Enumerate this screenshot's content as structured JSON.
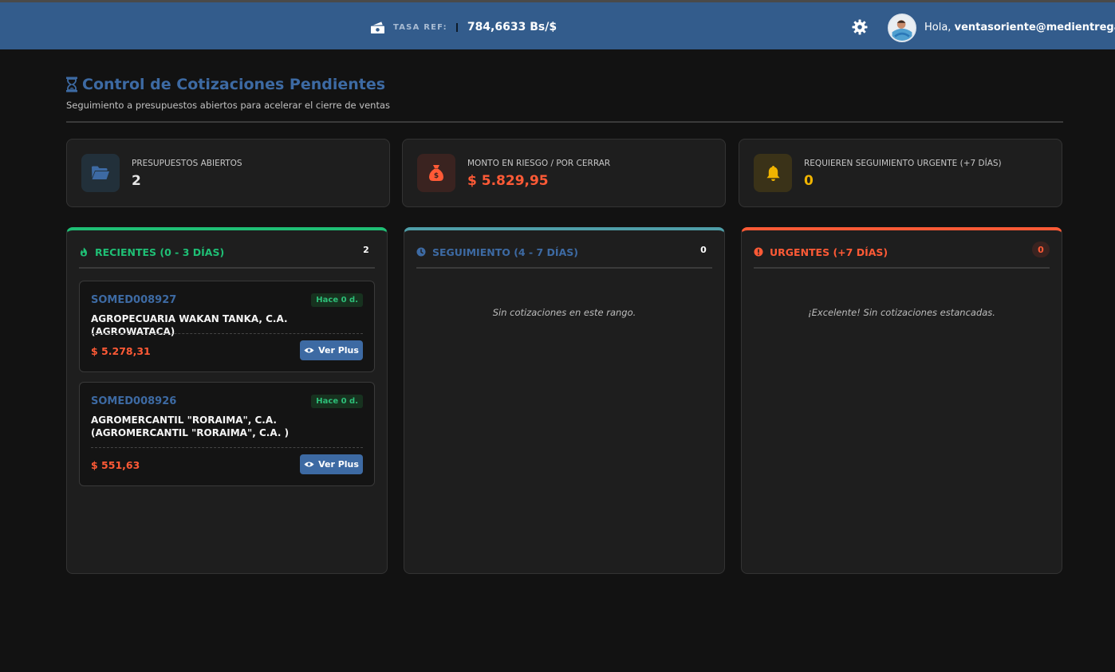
{
  "header": {
    "rate_label": "TASA REF:",
    "rate_value": "784,6633 Bs/$",
    "greeting_prefix": "Hola,",
    "user_email": "ventasoriente@medientregas.n",
    "icons": {
      "rate": "money-bill-icon",
      "settings": "gear-icon",
      "avatar": "user-avatar"
    }
  },
  "page": {
    "title": "Control de Cotizaciones Pendientes",
    "subtitle": "Seguimiento a presupuestos abiertos para acelerar el cierre de ventas",
    "title_icon": "hourglass-icon"
  },
  "stats": [
    {
      "label": "PRESUPUESTOS ABIERTOS",
      "value": "2",
      "icon": "folder-open-icon",
      "color": "#3d6aa3",
      "value_color": "#e6e6e6"
    },
    {
      "label": "MONTO EN RIESGO / POR CERRAR",
      "value": "$ 5.829,95",
      "icon": "money-bag-icon",
      "color": "#ff5a36",
      "value_color": "#ff5a36"
    },
    {
      "label": "REQUIEREN SEGUIMIENTO URGENTE (+7 DÍAS)",
      "value": "0",
      "icon": "bell-icon",
      "color": "#f0b400",
      "value_color": "#f0b400"
    }
  ],
  "columns": [
    {
      "title": "RECIENTES (0 - 3 DÍAS)",
      "count": "2",
      "color": "#1fbf75",
      "icon": "fire-icon",
      "cards": [
        {
          "code": "SOMED008927",
          "age": "Hace 0 d.",
          "client": "AGROPECUARIA WAKAN TANKA, C.A. (AGROWATACA)",
          "amount": "$ 5.278,31",
          "button": "Ver Plus"
        },
        {
          "code": "SOMED008926",
          "age": "Hace 0 d.",
          "client": "AGROMERCANTIL \"RORAIMA\", C.A. (AGROMERCANTIL \"RORAIMA\", C.A. )",
          "amount": "$ 551,63",
          "button": "Ver Plus"
        }
      ]
    },
    {
      "title": "SEGUIMIENTO (4 - 7 DÍAS)",
      "count": "0",
      "color": "#3d6aa3",
      "bar_color": "#4f9ea8",
      "icon": "clock-icon",
      "empty_text": "Sin cotizaciones en este rango."
    },
    {
      "title": "URGENTES (+7 DÍAS)",
      "count": "0",
      "color": "#ff5a36",
      "icon": "exclamation-circle-icon",
      "empty_text": "¡Excelente! Sin cotizaciones estancadas."
    }
  ],
  "colors": {
    "header_bg": "#335c8c",
    "page_bg": "#121212",
    "card_bg": "#1e1e1e",
    "accent": "#3d6aa3"
  }
}
